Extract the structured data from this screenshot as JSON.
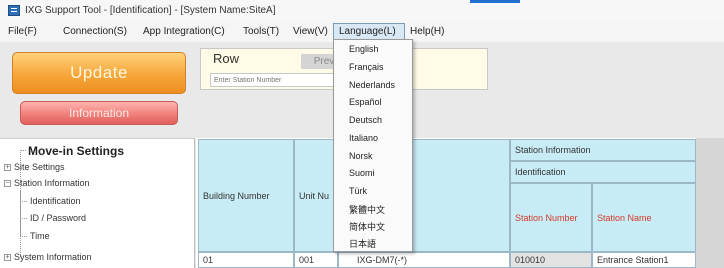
{
  "window": {
    "title": "IXG Support Tool - [Identification] - [System Name:SiteA]"
  },
  "menubar": {
    "items": [
      "File(F)",
      "Connection(S)",
      "App Integration(C)",
      "Tools(T)",
      "View(V)",
      "Language(L)",
      "Help(H)"
    ]
  },
  "toolbar": {
    "update_label": "Update",
    "information_label": "Information",
    "row_label": "Row",
    "prev_label": "Prev",
    "station_placeholder": "Enter Station Number"
  },
  "tree": {
    "title": "Move-in Settings",
    "items": [
      "Site Settings",
      "Station Information",
      "Identification",
      "ID / Password",
      "Time",
      "System Information"
    ]
  },
  "table": {
    "headers": {
      "building_number": "Building Number",
      "unit_number": "Unit Nu",
      "station_information": "Station Information",
      "identification": "Identification",
      "station_number": "Station Number",
      "station_name": "Station Name"
    },
    "rows": [
      {
        "building": "01",
        "unit": "001",
        "type": "IXG-DM7(-*)",
        "station_number": "010010",
        "station_name": "Entrance Station1"
      }
    ]
  },
  "language_menu": {
    "options": [
      "English",
      "Français",
      "Nederlands",
      "Español",
      "Deutsch",
      "Italiano",
      "Norsk",
      "Suomi",
      "Türk",
      "繁體中文",
      "简体中文",
      "日本語"
    ]
  },
  "colors": {
    "update_button": "#f6a63a",
    "information_button": "#f0807b",
    "grid_header": "#c8ecf5",
    "highlight_text": "#d33a2a"
  }
}
